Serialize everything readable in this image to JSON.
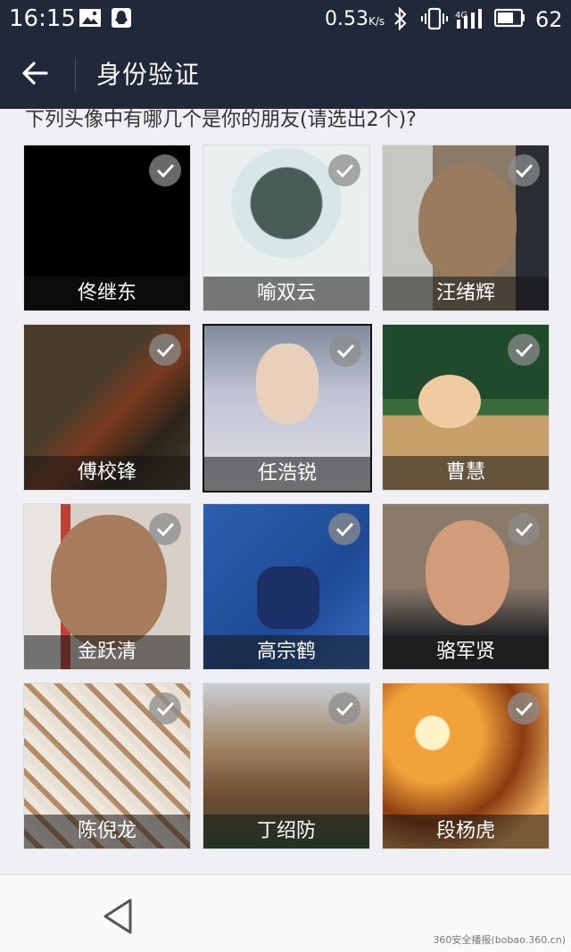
{
  "status_bar": {
    "time": "16:15",
    "speed": "0.53",
    "speed_unit": "K/s",
    "network": "4G",
    "battery": "62",
    "icons": [
      "image-icon",
      "qq-icon",
      "bluetooth-icon",
      "vibrate-icon",
      "signal-icon",
      "battery-icon"
    ]
  },
  "header": {
    "back_icon": "back-arrow-icon",
    "title": "身份验证"
  },
  "prompt": "下列头像中有哪几个是你的朋友(请选出2个)?",
  "friends": [
    {
      "name": "佟继东"
    },
    {
      "name": "喻双云"
    },
    {
      "name": "汪绪辉"
    },
    {
      "name": "傅校锋"
    },
    {
      "name": "任浩锐"
    },
    {
      "name": "曹慧"
    },
    {
      "name": "金跃清"
    },
    {
      "name": "高宗鹤"
    },
    {
      "name": "骆军贤"
    },
    {
      "name": "陈倪龙"
    },
    {
      "name": "丁绍防"
    },
    {
      "name": "段杨虎"
    }
  ],
  "nav": {
    "back_icon": "nav-back-triangle-icon"
  },
  "watermark": "360安全播报(bobao.360.cn)"
}
